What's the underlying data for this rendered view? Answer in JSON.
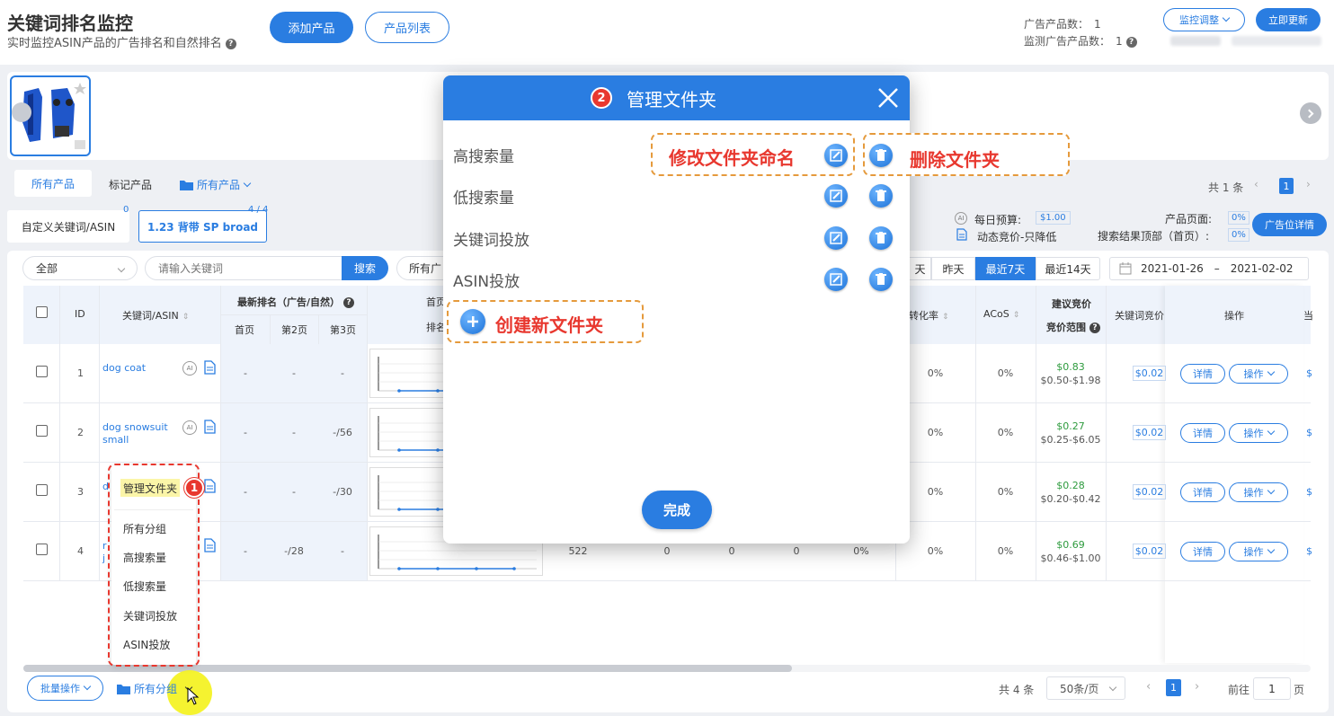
{
  "header": {
    "title": "关键词排名监控",
    "subtitle": "实时监控ASIN产品的广告排名和自然排名",
    "add_product": "添加产品",
    "product_list": "产品列表",
    "ad_products_label": "广告产品数：",
    "ad_products_value": "1",
    "monitored_label": "监测广告产品数：",
    "monitored_value": "1",
    "monitor_adjust": "监控调整",
    "update_now": "立即更新",
    "blurred_account": "████████",
    "blurred_time": "2021-02-02 15:00"
  },
  "tabs": {
    "all_products": "所有产品",
    "marked_products": "标记产品",
    "folder_all": "所有产品",
    "count_text": "共 1 条",
    "page": "1"
  },
  "campaign": {
    "custom_kw": "自定义关键词/ASIN",
    "custom_kw_badge": "0",
    "campaign_name": "1.23 背带 SP broad",
    "campaign_badge": "4 / 4",
    "daily_budget_label": "每日预算:",
    "daily_budget_value": "$1.00",
    "dynamic_bid": "动态竞价-只降低",
    "product_page_label": "产品页面:",
    "product_page_value": "0%",
    "search_top_label": "搜索结果顶部（首页）:",
    "search_top_value": "0%",
    "placement_details": "广告位详情"
  },
  "filters": {
    "all": "全部",
    "search_placeholder": "请输入关键词",
    "search_btn": "搜索",
    "all_ads": "所有广",
    "range_tian": "天",
    "yesterday": "昨天",
    "last7": "最近7天",
    "last14": "最近14天",
    "date_from": "2021-01-26",
    "date_sep": "–",
    "date_to": "2021-02-02"
  },
  "table": {
    "headers": {
      "id": "ID",
      "keyword": "关键词/ASIN",
      "latest_rank": "最新排名（广告/自然）",
      "p1": "首页",
      "p2": "第2页",
      "p3": "第3页",
      "first_page": "首页",
      "rank": "排名",
      "cvr": "单转化率",
      "acos": "ACoS",
      "suggested_bid": "建议竞价",
      "bid_range": "竞价范围",
      "kw_bid": "关键词竞价",
      "ops": "操作",
      "cut": "当"
    },
    "rows": [
      {
        "id": "1",
        "kw": "dog coat",
        "kw2": "",
        "p1": "-",
        "p2": "-",
        "p3": "-",
        "num": "",
        "a": "",
        "b": "",
        "c": "",
        "d": "",
        "cvr": "0%",
        "acos": "0%",
        "bid": "$0.83",
        "range": "$0.50-$1.98",
        "kwbid": "$0.02"
      },
      {
        "id": "2",
        "kw": "dog snowsuit",
        "kw2": "small",
        "p1": "-",
        "p2": "-",
        "p3": "-/56",
        "num": "",
        "a": "",
        "b": "",
        "c": "",
        "d": "",
        "cvr": "0%",
        "acos": "0%",
        "bid": "$0.27",
        "range": "$0.25-$6.05",
        "kwbid": "$0.02"
      },
      {
        "id": "3",
        "kw": "d",
        "kw2": "",
        "p1": "-",
        "p2": "-",
        "p3": "-/30",
        "num": "",
        "a": "",
        "b": "",
        "c": "",
        "d": "",
        "cvr": "0%",
        "acos": "0%",
        "bid": "$0.28",
        "range": "$0.20-$0.42",
        "kwbid": "$0.02"
      },
      {
        "id": "4",
        "kw": "r",
        "kw2": "j",
        "p1": "-",
        "p2": "-/28",
        "p3": "-",
        "num": "522",
        "a": "0",
        "b": "0",
        "c": "0",
        "d": "0%",
        "cvr": "0%",
        "acos": "0%",
        "bid": "$0.69",
        "range": "$0.46-$1.00",
        "kwbid": "$0.02"
      }
    ],
    "detail_btn": "详情",
    "op_btn": "操作"
  },
  "bottom": {
    "batch": "批量操作",
    "folder": "所有分组",
    "total": "共 4 条",
    "per_page": "50条/页",
    "page": "1",
    "goto": "前往",
    "goto_page": "1",
    "page_unit": "页"
  },
  "dropdown": {
    "manage": "管理文件夹",
    "step": "1",
    "items": [
      "所有分组",
      "高搜索量",
      "低搜索量",
      "关键词投放",
      "ASIN投放"
    ]
  },
  "modal": {
    "step": "2",
    "title": "管理文件夹",
    "folders": [
      "高搜索量",
      "低搜索量",
      "关键词投放",
      "ASIN投放"
    ],
    "rename_callout": "修改文件夹命名",
    "delete_callout": "删除文件夹",
    "create": "创建新文件夹",
    "done": "完成"
  },
  "colors": {
    "accent": "#2a7de1",
    "callout_red": "#e8382f",
    "green": "#2e9b3e"
  }
}
